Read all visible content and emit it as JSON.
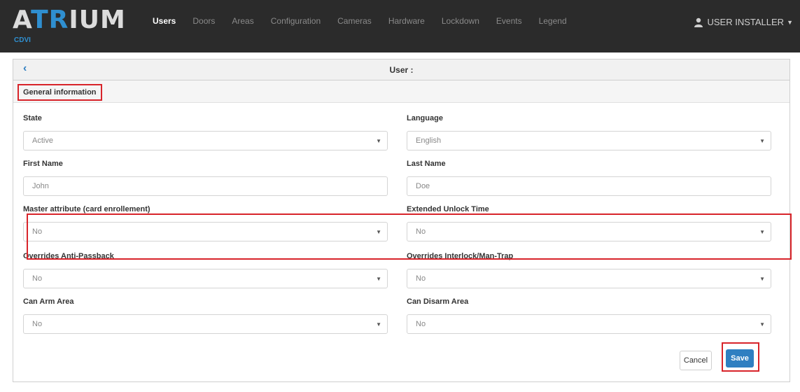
{
  "brand": {
    "name_prefix": "A",
    "name_accent": "TR",
    "name_suffix": "IUM",
    "sub": "CDVI"
  },
  "nav": {
    "items": [
      {
        "label": "Users",
        "active": true
      },
      {
        "label": "Doors"
      },
      {
        "label": "Areas"
      },
      {
        "label": "Configuration"
      },
      {
        "label": "Cameras"
      },
      {
        "label": "Hardware"
      },
      {
        "label": "Lockdown"
      },
      {
        "label": "Events"
      },
      {
        "label": "Legend"
      }
    ],
    "user": "USER INSTALLER"
  },
  "panel": {
    "title": "User :",
    "section": "General information"
  },
  "fields": {
    "state": {
      "label": "State",
      "value": "Active"
    },
    "language": {
      "label": "Language",
      "value": "English"
    },
    "first_name": {
      "label": "First Name",
      "value": "John"
    },
    "last_name": {
      "label": "Last Name",
      "value": "Doe"
    },
    "master": {
      "label": "Master attribute (card enrollement)",
      "value": "No"
    },
    "extended": {
      "label": "Extended Unlock Time",
      "value": "No"
    },
    "anti_passback": {
      "label": "Overrides Anti-Passback",
      "value": "No"
    },
    "interlock": {
      "label": "Overrides Interlock/Man-Trap",
      "value": "No"
    },
    "arm": {
      "label": "Can Arm Area",
      "value": "No"
    },
    "disarm": {
      "label": "Can Disarm Area",
      "value": "No"
    }
  },
  "actions": {
    "cancel": "Cancel",
    "save": "Save"
  },
  "colors": {
    "navbar": "#2b2b2b",
    "accent": "#2f7fc1",
    "highlight": "#d8242a"
  }
}
